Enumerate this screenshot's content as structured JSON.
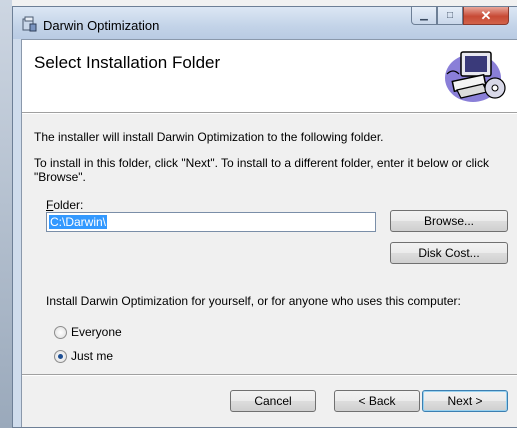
{
  "window": {
    "title": "Darwin Optimization",
    "minimize_glyph": "▁",
    "maximize_glyph": "□",
    "close_glyph": "✕"
  },
  "header": {
    "title": "Select Installation Folder",
    "art_icon": "computer-with-cd-icon"
  },
  "body": {
    "line1": "The installer will install Darwin Optimization to the following folder.",
    "line2": "To install in this folder, click \"Next\". To install to a different folder, enter it below or click \"Browse\"."
  },
  "folder": {
    "label_accel": "F",
    "label_rest": "older:",
    "value": "C:\\Darwin\\"
  },
  "buttons": {
    "browse": "Browse...",
    "disk_cost": "Disk Cost...",
    "cancel": "Cancel",
    "back": "< Back",
    "next": "Next >"
  },
  "install_for": {
    "question": "Install Darwin Optimization for yourself, or for anyone who uses this computer:",
    "options": [
      {
        "label": "Everyone",
        "selected": false
      },
      {
        "label": "Just me",
        "selected": true
      }
    ]
  },
  "colors": {
    "selection": "#3399ff",
    "close_button": "#c74a35",
    "radio_dot": "#1e4f93"
  }
}
